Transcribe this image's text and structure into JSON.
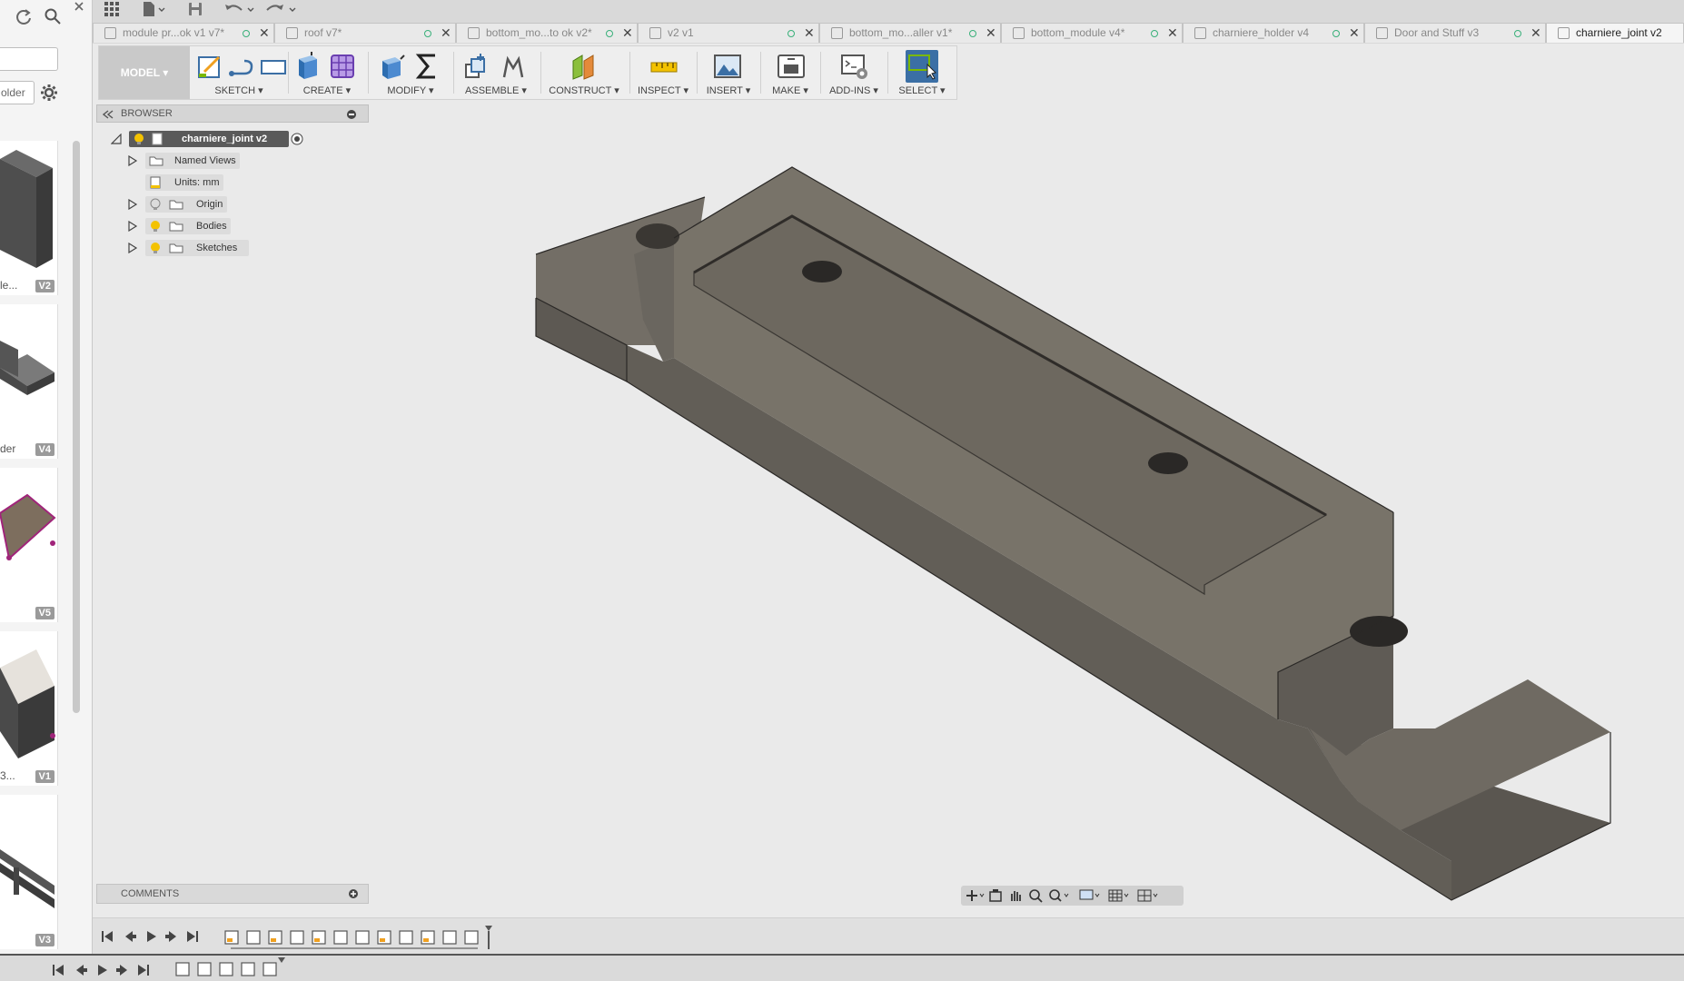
{
  "tabs": [
    {
      "label": "module pr...ok v1 v7*",
      "active": false
    },
    {
      "label": "roof v7*",
      "active": false
    },
    {
      "label": "bottom_mo...to ok v2*",
      "active": false
    },
    {
      "label": "v2 v1",
      "active": false
    },
    {
      "label": "bottom_mo...aller v1*",
      "active": false
    },
    {
      "label": "bottom_module v4*",
      "active": false
    },
    {
      "label": "charniere_holder v4",
      "active": false
    },
    {
      "label": "Door and Stuff v3",
      "active": false
    },
    {
      "label": "charniere_joint v2",
      "active": true
    }
  ],
  "data_panel": {
    "folder_label": "older",
    "thumbnails": [
      {
        "name": "le...",
        "version": "V2"
      },
      {
        "name": "der",
        "version": "V4"
      },
      {
        "name": "",
        "version": "V5"
      },
      {
        "name": "3...",
        "version": "V1"
      },
      {
        "name": "",
        "version": "V3"
      }
    ]
  },
  "toolbar": {
    "workspace": "MODEL ▾",
    "groups": [
      {
        "label": "SKETCH ▾"
      },
      {
        "label": "CREATE ▾"
      },
      {
        "label": "MODIFY ▾"
      },
      {
        "label": "ASSEMBLE ▾"
      },
      {
        "label": "CONSTRUCT ▾"
      },
      {
        "label": "INSPECT ▾"
      },
      {
        "label": "INSERT ▾"
      },
      {
        "label": "MAKE ▾"
      },
      {
        "label": "ADD-INS ▾"
      },
      {
        "label": "SELECT ▾"
      }
    ]
  },
  "browser": {
    "title": "BROWSER",
    "root": "charniere_joint v2",
    "nodes": [
      {
        "label": "Named Views"
      },
      {
        "label": "Units: mm"
      },
      {
        "label": "Origin"
      },
      {
        "label": "Bodies"
      },
      {
        "label": "Sketches"
      }
    ]
  },
  "comments": {
    "title": "COMMENTS"
  },
  "colors": {
    "model_face_top": "#716c64",
    "model_face_front": "#5f5b55",
    "select_blue": "#3b6fa5",
    "bulb": "#f3c200"
  }
}
